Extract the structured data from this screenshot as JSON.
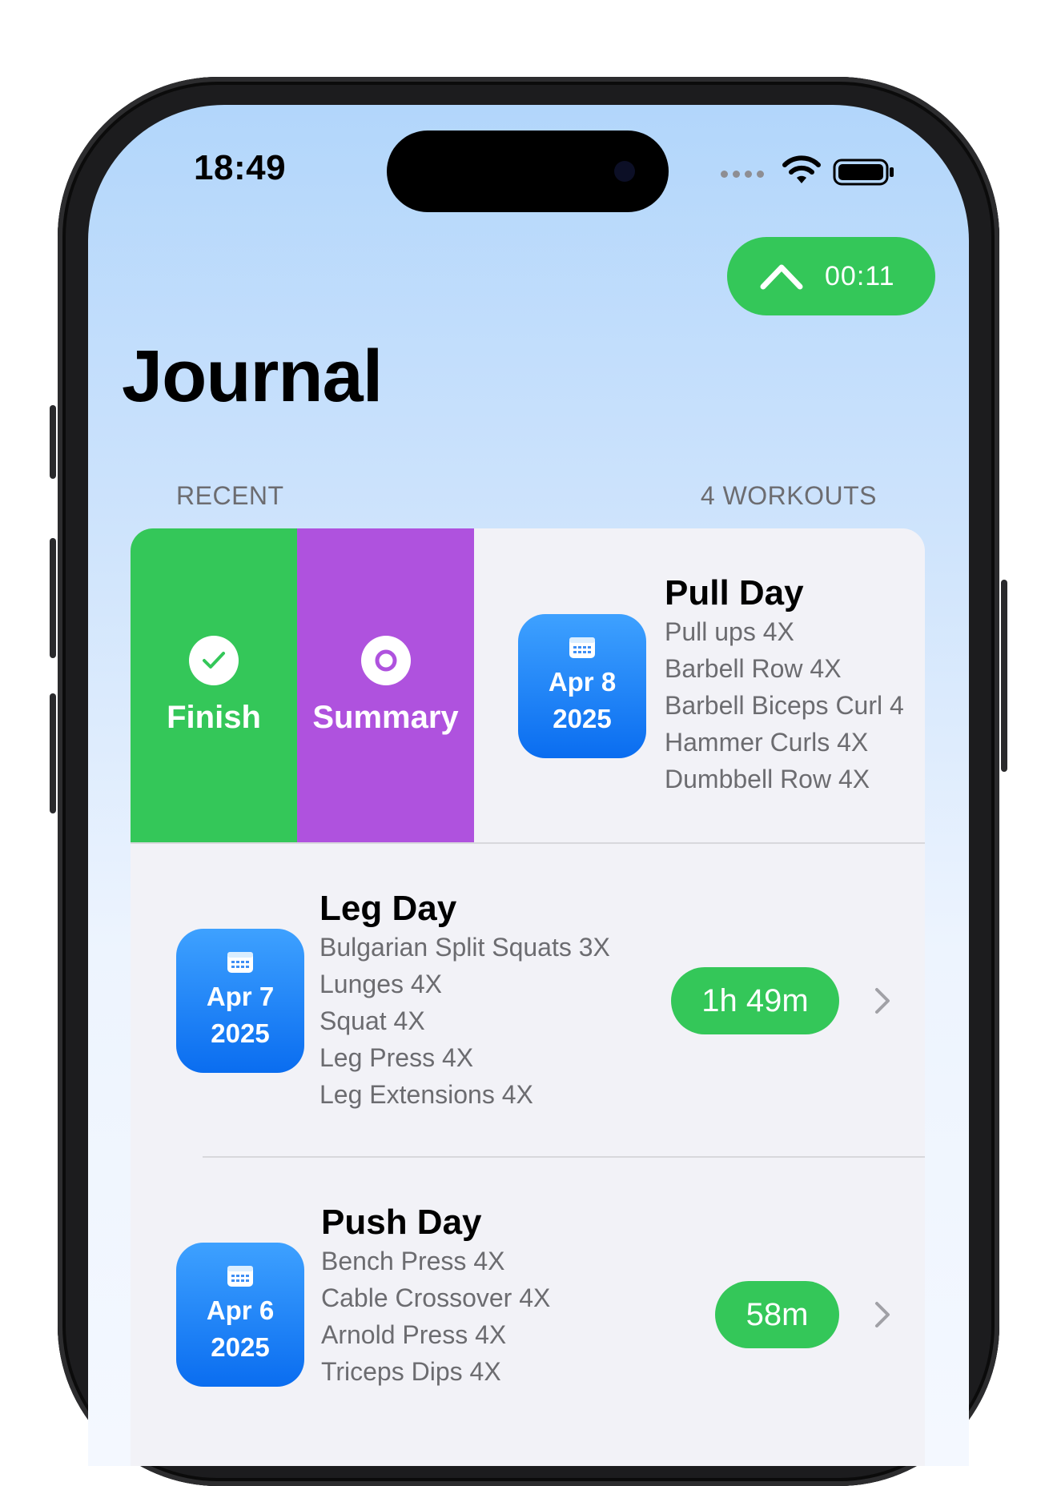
{
  "status_bar": {
    "time": "18:49"
  },
  "timer": {
    "value": "00:11",
    "icon": "chevron-up-icon"
  },
  "title": "Journal",
  "section": {
    "left": "RECENT",
    "right": "4 WORKOUTS"
  },
  "swipe_actions": [
    {
      "label": "Finish",
      "icon": "checkmark-circle-icon",
      "color": "#34c759"
    },
    {
      "label": "Summary",
      "icon": "record-circle-icon",
      "color": "#af52de"
    }
  ],
  "workouts": [
    {
      "title": "Pull Day",
      "date_md": "Apr 8",
      "date_year": "2025",
      "exercises": [
        "Pull ups 4X",
        "Barbell Row 4X",
        "Barbell Biceps Curl 4",
        "Hammer Curls 4X",
        "Dumbbell Row 4X"
      ]
    },
    {
      "title": "Leg Day",
      "date_md": "Apr 7",
      "date_year": "2025",
      "duration": "1h 49m",
      "exercises": [
        "Bulgarian Split Squats 3X",
        "Lunges 4X",
        "Squat 4X",
        "Leg Press 4X",
        "Leg Extensions 4X"
      ]
    },
    {
      "title": "Push Day",
      "date_md": "Apr 6",
      "date_year": "2025",
      "duration": "58m",
      "exercises": [
        "Bench Press 4X",
        "Cable Crossover 4X",
        "Arnold Press 4X",
        "Triceps Dips 4X"
      ]
    }
  ],
  "colors": {
    "accent_green": "#34c759",
    "accent_purple": "#af52de",
    "date_blue": "#0a6df0"
  }
}
